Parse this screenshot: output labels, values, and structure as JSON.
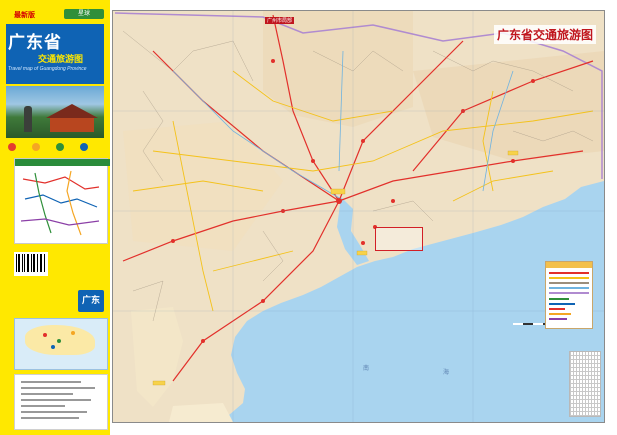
{
  "cover": {
    "edition_badge": "最新版",
    "publisher_tag": "星球",
    "title": "广东省",
    "subtitle": "交通旅游图",
    "english_title": "Travel map of Guangdong Province",
    "side_tag": "广东"
  },
  "map": {
    "title": "广东省交通旅游图",
    "inset_label": "广州市局部",
    "sea_labels": [
      "南",
      "海"
    ]
  },
  "colors": {
    "cover_yellow": "#ffe800",
    "title_blue": "#0f63b4",
    "title_red": "#c0161e",
    "land": "#efe1c6",
    "sea": "#a9d4ef",
    "road_red": "#e2302b",
    "road_yellow": "#f4c21a"
  }
}
